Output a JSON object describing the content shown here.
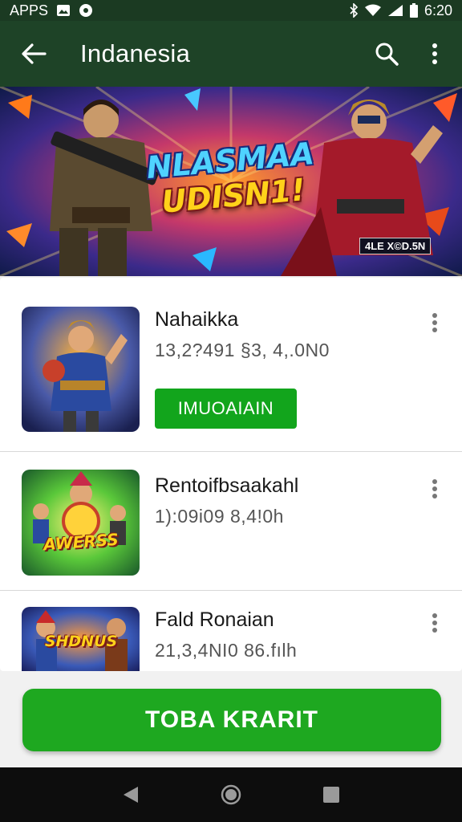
{
  "status_bar": {
    "left_text": "APPS",
    "time": "6:20",
    "icons": [
      "image-icon",
      "circle-notification-icon",
      "bluetooth-icon",
      "wifi-icon",
      "signal-icon",
      "battery-icon"
    ]
  },
  "app_bar": {
    "title": "Indanesia",
    "back_icon": "arrow-left-icon",
    "search_icon": "search-icon",
    "more_icon": "more-vert-icon",
    "background": "#1e4327"
  },
  "banner": {
    "title_line1": "NLASMAA",
    "title_line2": "UDISN1!",
    "badge": "4LE X©D.5N"
  },
  "apps": [
    {
      "name": "Nahaikka",
      "meta": "13,2?491 §3, 4,.0N0",
      "button_label": "IMUOAIAIN"
    },
    {
      "name": "Rentoifbsaakahl",
      "meta": "1):09i09 8,4!0h",
      "button_label": ""
    },
    {
      "name": "Fald Ronaian",
      "meta": "21,3,4NI0 86.fılh",
      "button_label": ""
    }
  ],
  "thumb_captions": {
    "second": "AWERSS",
    "third": "SHDNUS"
  },
  "primary_button": {
    "label": "TOBA KRARIT",
    "color": "#1ea820"
  },
  "nav_bar": {
    "icons": [
      "back-triangle-icon",
      "home-circle-icon",
      "recents-square-icon"
    ]
  },
  "colors": {
    "accent_green": "#12a51c",
    "status_bar_bg": "#1b3a22",
    "app_bar_bg": "#1e4327"
  }
}
